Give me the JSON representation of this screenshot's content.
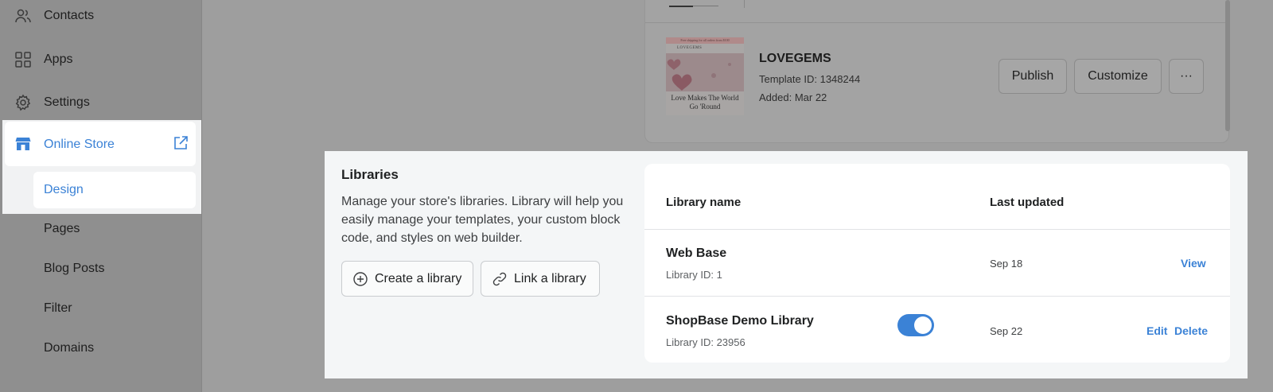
{
  "sidebar": {
    "items": [
      {
        "label": "Contacts",
        "icon": "contacts-icon"
      },
      {
        "label": "Apps",
        "icon": "apps-icon"
      },
      {
        "label": "Settings",
        "icon": "gear-icon"
      }
    ],
    "online_store": {
      "label": "Online Store",
      "icon": "store-icon",
      "external_icon": "external-link-icon"
    },
    "sub_items": [
      "Design",
      "Pages",
      "Blog Posts",
      "Filter",
      "Domains"
    ]
  },
  "template_card": {
    "name": "LOVEGEMS",
    "template_id": "Template ID: 1348244",
    "added": "Added: Mar 22",
    "thumbnail": {
      "banner": "Free shipping for all orders from $100",
      "brand": "LOVEGEMS",
      "tagline": "Love Makes The World Go 'Round"
    },
    "buttons": {
      "publish": "Publish",
      "customize": "Customize",
      "more": "···"
    }
  },
  "libraries": {
    "title": "Libraries",
    "description": "Manage your store's libraries. Library will help you easily manage your templates, your custom block code, and styles on web builder.",
    "create_button": "Create a library",
    "link_button": "Link a library",
    "table": {
      "headers": {
        "name": "Library name",
        "updated": "Last updated"
      },
      "rows": [
        {
          "name": "Web Base",
          "id": "Library ID: 1",
          "updated": "Sep 18",
          "actions": [
            "View"
          ],
          "toggle": null
        },
        {
          "name": "ShopBase Demo Library",
          "id": "Library ID: 23956",
          "updated": "Sep 22",
          "actions": [
            "Edit",
            "Delete"
          ],
          "toggle": true
        }
      ]
    }
  },
  "colors": {
    "accent": "#3b82d6",
    "overlay": "#9e9e9e",
    "panel": "#f4f6f7"
  }
}
